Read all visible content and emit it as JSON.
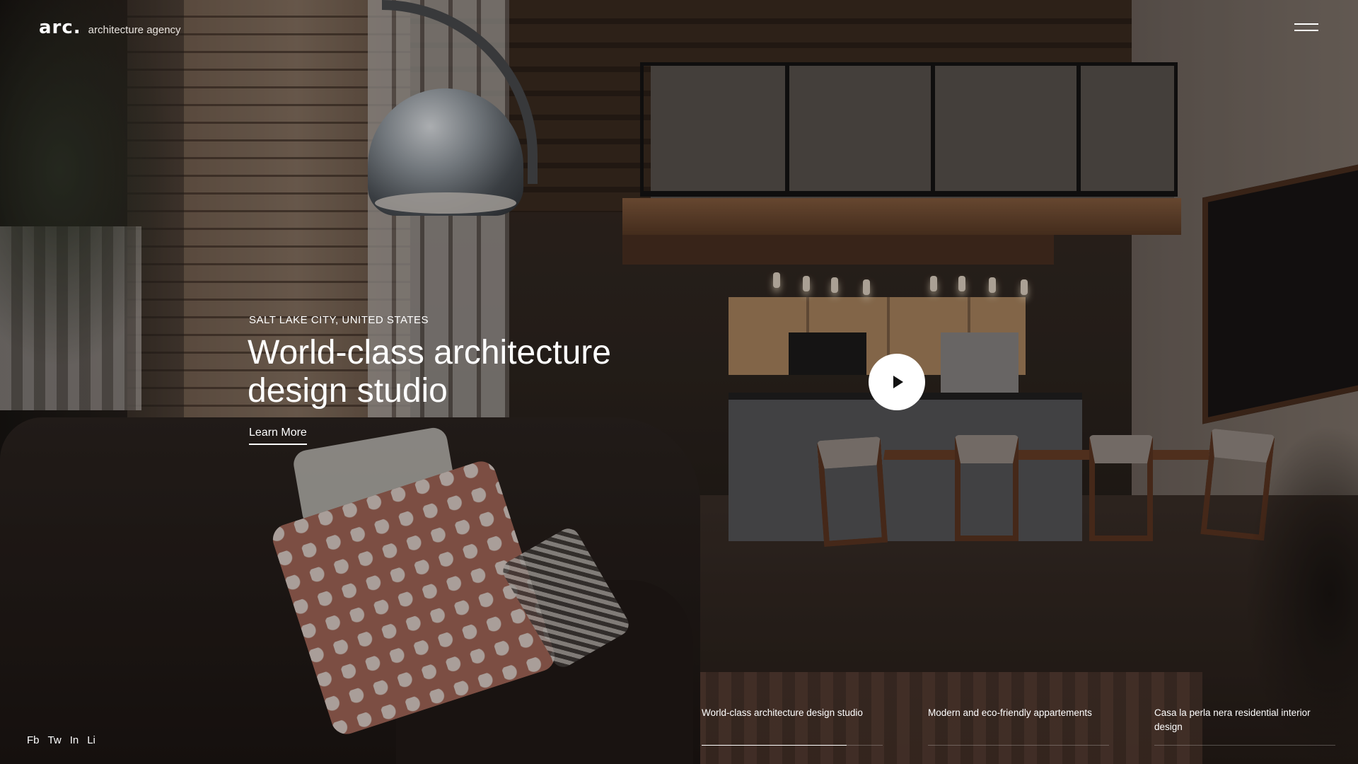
{
  "brand": {
    "logo": "arc.",
    "tagline": "architecture agency"
  },
  "header": {
    "menu_icon": "hamburger-menu-icon"
  },
  "hero": {
    "location": "SALT LAKE CITY, UNITED STATES",
    "headline_line1": "World-class architecture",
    "headline_line2": "design studio",
    "cta_label": "Learn More",
    "play_icon": "play-icon"
  },
  "social": {
    "items": [
      "Fb",
      "Tw",
      "In",
      "Li"
    ]
  },
  "slides": {
    "items": [
      {
        "label": "World-class architecture design studio",
        "progress": 0.8
      },
      {
        "label": "Modern and eco-friendly appartements",
        "progress": 0
      },
      {
        "label": "Casa la perla nera residential interior design",
        "progress": 0
      }
    ]
  },
  "colors": {
    "text": "#ffffff",
    "play_button_bg": "#ffffff",
    "play_icon": "#111111"
  }
}
